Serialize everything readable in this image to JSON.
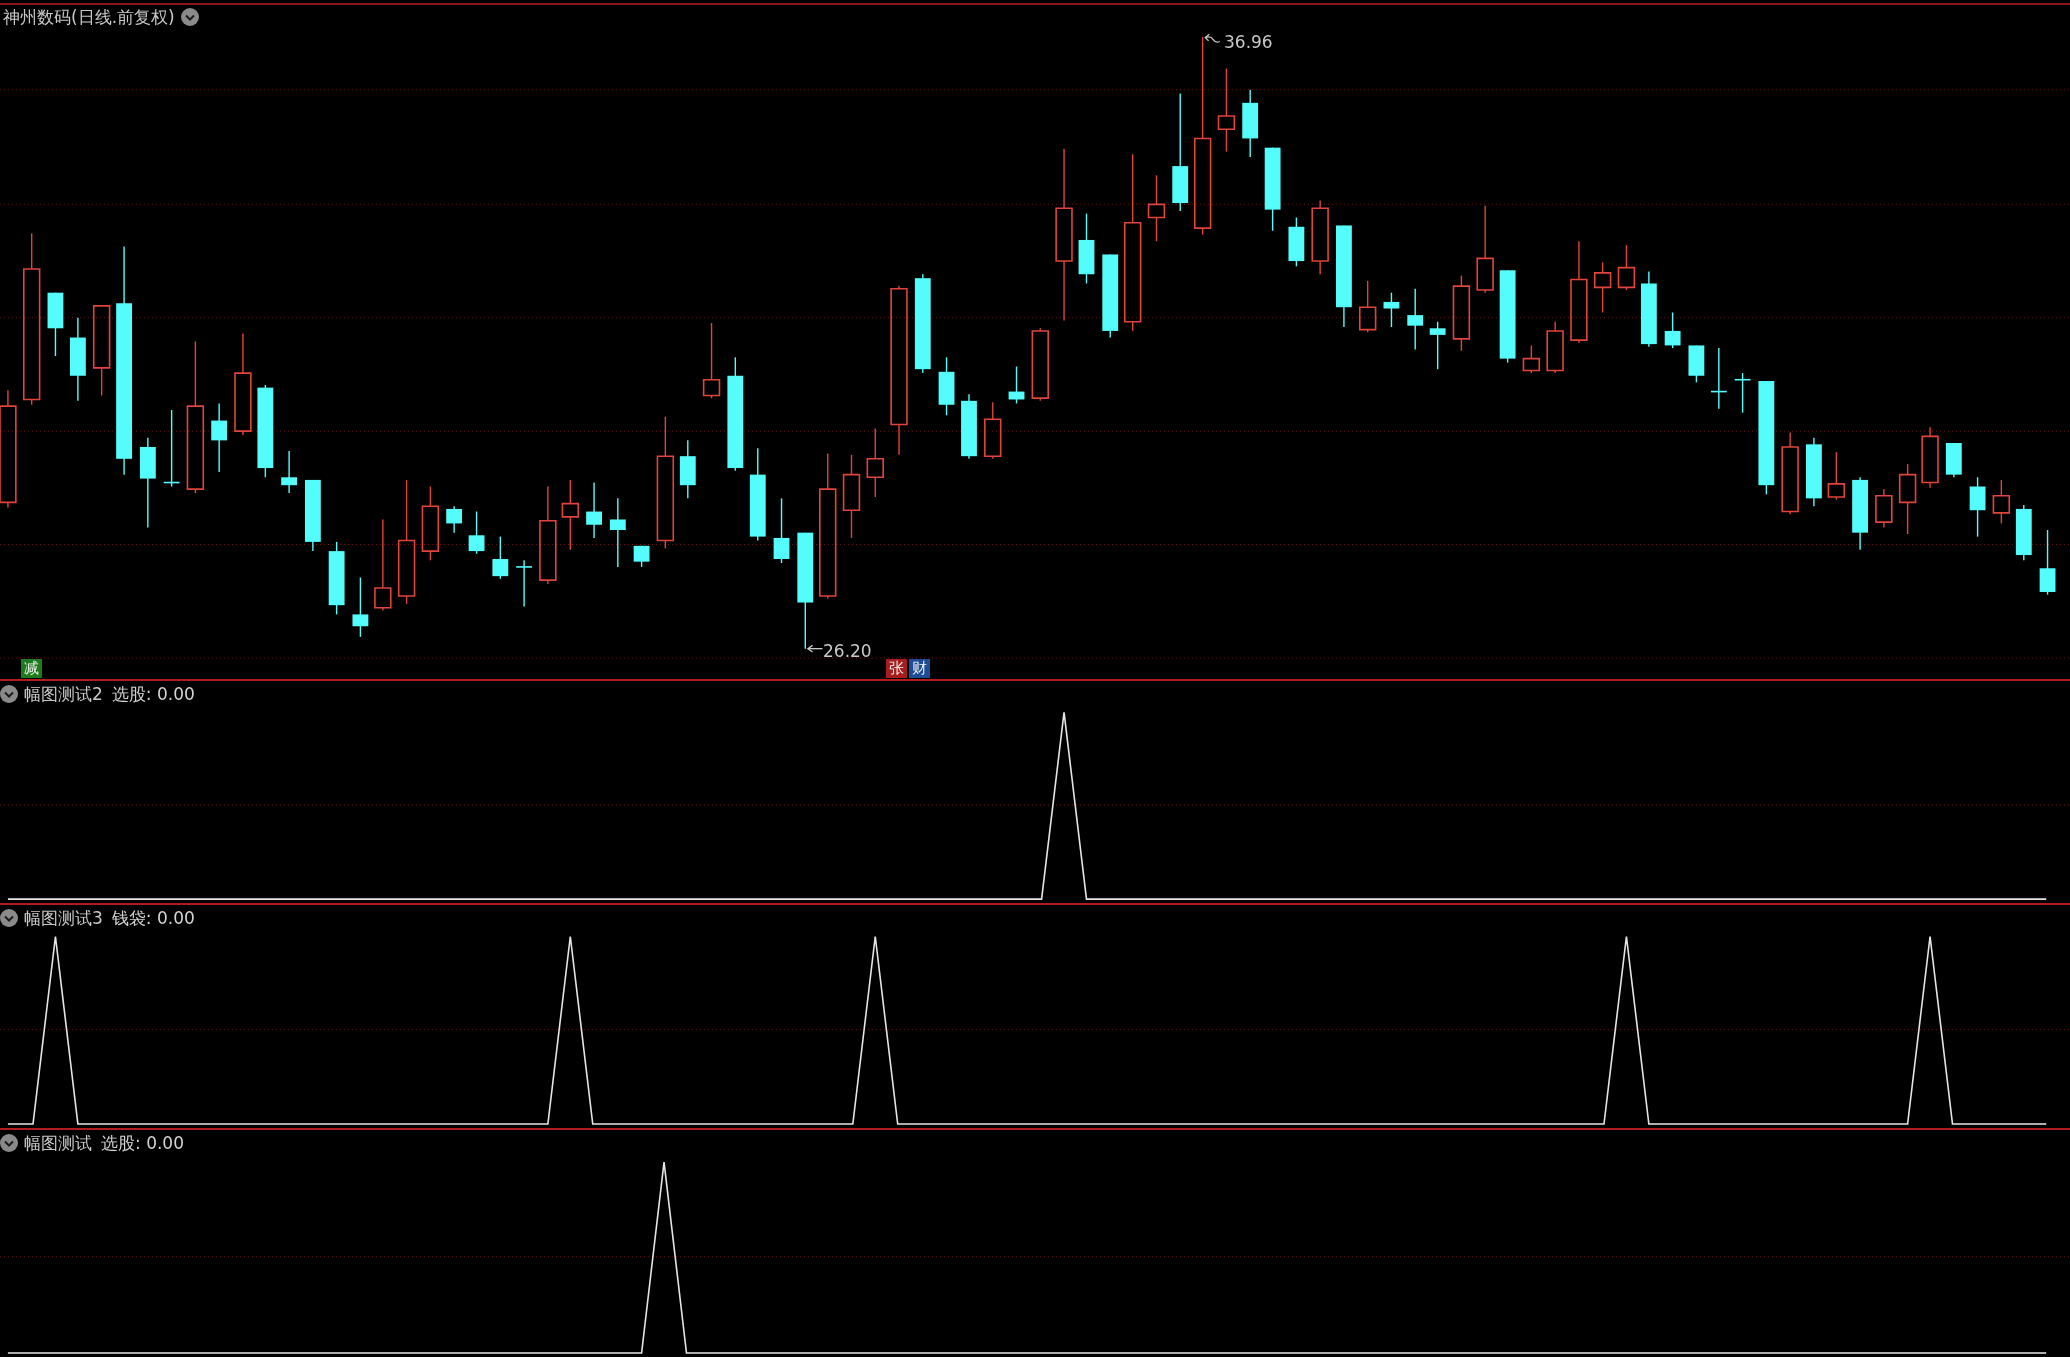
{
  "header": {
    "title": "神州数码(日线.前复权)"
  },
  "main_chart": {
    "high_label": "36.96",
    "low_label": "26.20",
    "markers": [
      {
        "text": "减",
        "color": "#1d7a1d"
      },
      {
        "text": "张",
        "color": "#a51d1d"
      },
      {
        "text": "财",
        "color": "#1d4b96"
      }
    ]
  },
  "indicator_panels": [
    {
      "title": "幅图测试2",
      "reading": "选股: 0.00"
    },
    {
      "title": "幅图测试3",
      "reading": "钱袋: 0.00"
    },
    {
      "title": "幅图测试",
      "reading": "选股: 0.00"
    }
  ]
}
